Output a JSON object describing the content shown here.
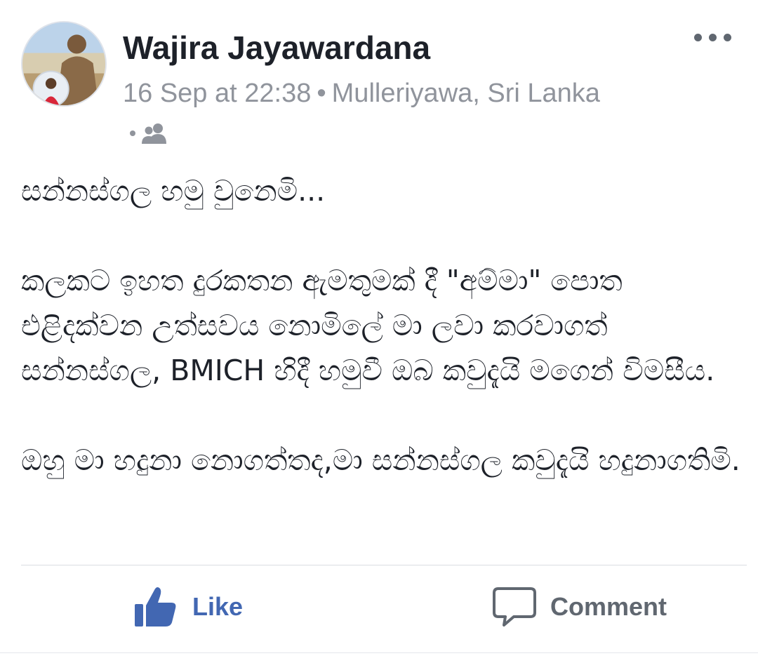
{
  "post": {
    "author": "Wajira Jayawardana",
    "timestamp": "16 Sep at 22:38",
    "separator": "•",
    "location": "Mulleriyawa, Sri Lanka",
    "audience_icon": "friends-icon",
    "paragraphs": [
      "සන්නස්ගල හමු වුනෙමි...",
      "කලකට ඉහත දුරකතන ඇමතුමක් දී \"අම්මා\" පොත එළිදක්වන උත්සවය නොමිලේ මා ලවා කරවාගත් සන්නස්ගල, BMICH හිදී හමුවී ඔබ කවුදැයි මගෙන් විමසීය.",
      "ඔහු මා හදුනා නොගත්තද,මා සන්නස්ගල කවුදැයි හදුනාගතිමි."
    ]
  },
  "actions": {
    "like_label": "Like",
    "like_icon": "thumbs-up-icon",
    "comment_label": "Comment",
    "comment_icon": "speech-bubble-icon",
    "more_icon": "more-options-icon"
  },
  "colors": {
    "like_blue": "#4267b2",
    "meta_gray": "#90949c",
    "text_dark": "#1d2129",
    "action_gray": "#606770"
  }
}
